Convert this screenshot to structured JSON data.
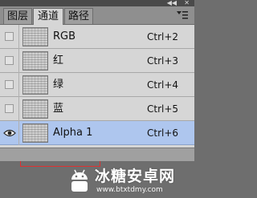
{
  "tabs": [
    {
      "label": "图层",
      "active": false
    },
    {
      "label": "通道",
      "active": true
    },
    {
      "label": "路径",
      "active": false
    }
  ],
  "channels": [
    {
      "name": "RGB",
      "shortcut": "Ctrl+2",
      "visible": false,
      "selected": false
    },
    {
      "name": "红",
      "shortcut": "Ctrl+3",
      "visible": false,
      "selected": false
    },
    {
      "name": "绿",
      "shortcut": "Ctrl+4",
      "visible": false,
      "selected": false
    },
    {
      "name": "蓝",
      "shortcut": "Ctrl+5",
      "visible": false,
      "selected": false
    },
    {
      "name": "Alpha 1",
      "shortcut": "Ctrl+6",
      "visible": true,
      "selected": true
    }
  ],
  "icons": {
    "collapse": "double-arrow-icon",
    "close": "close-icon",
    "menu": "panel-menu-icon",
    "visibility": "eye-icon"
  },
  "watermark": {
    "title": "冰糖安卓网",
    "url": "www.btxtdmy.com"
  },
  "colors": {
    "panel_bg": "#d6d6d6",
    "selected_row": "#aec6ee",
    "highlight_border": "#e03030"
  }
}
